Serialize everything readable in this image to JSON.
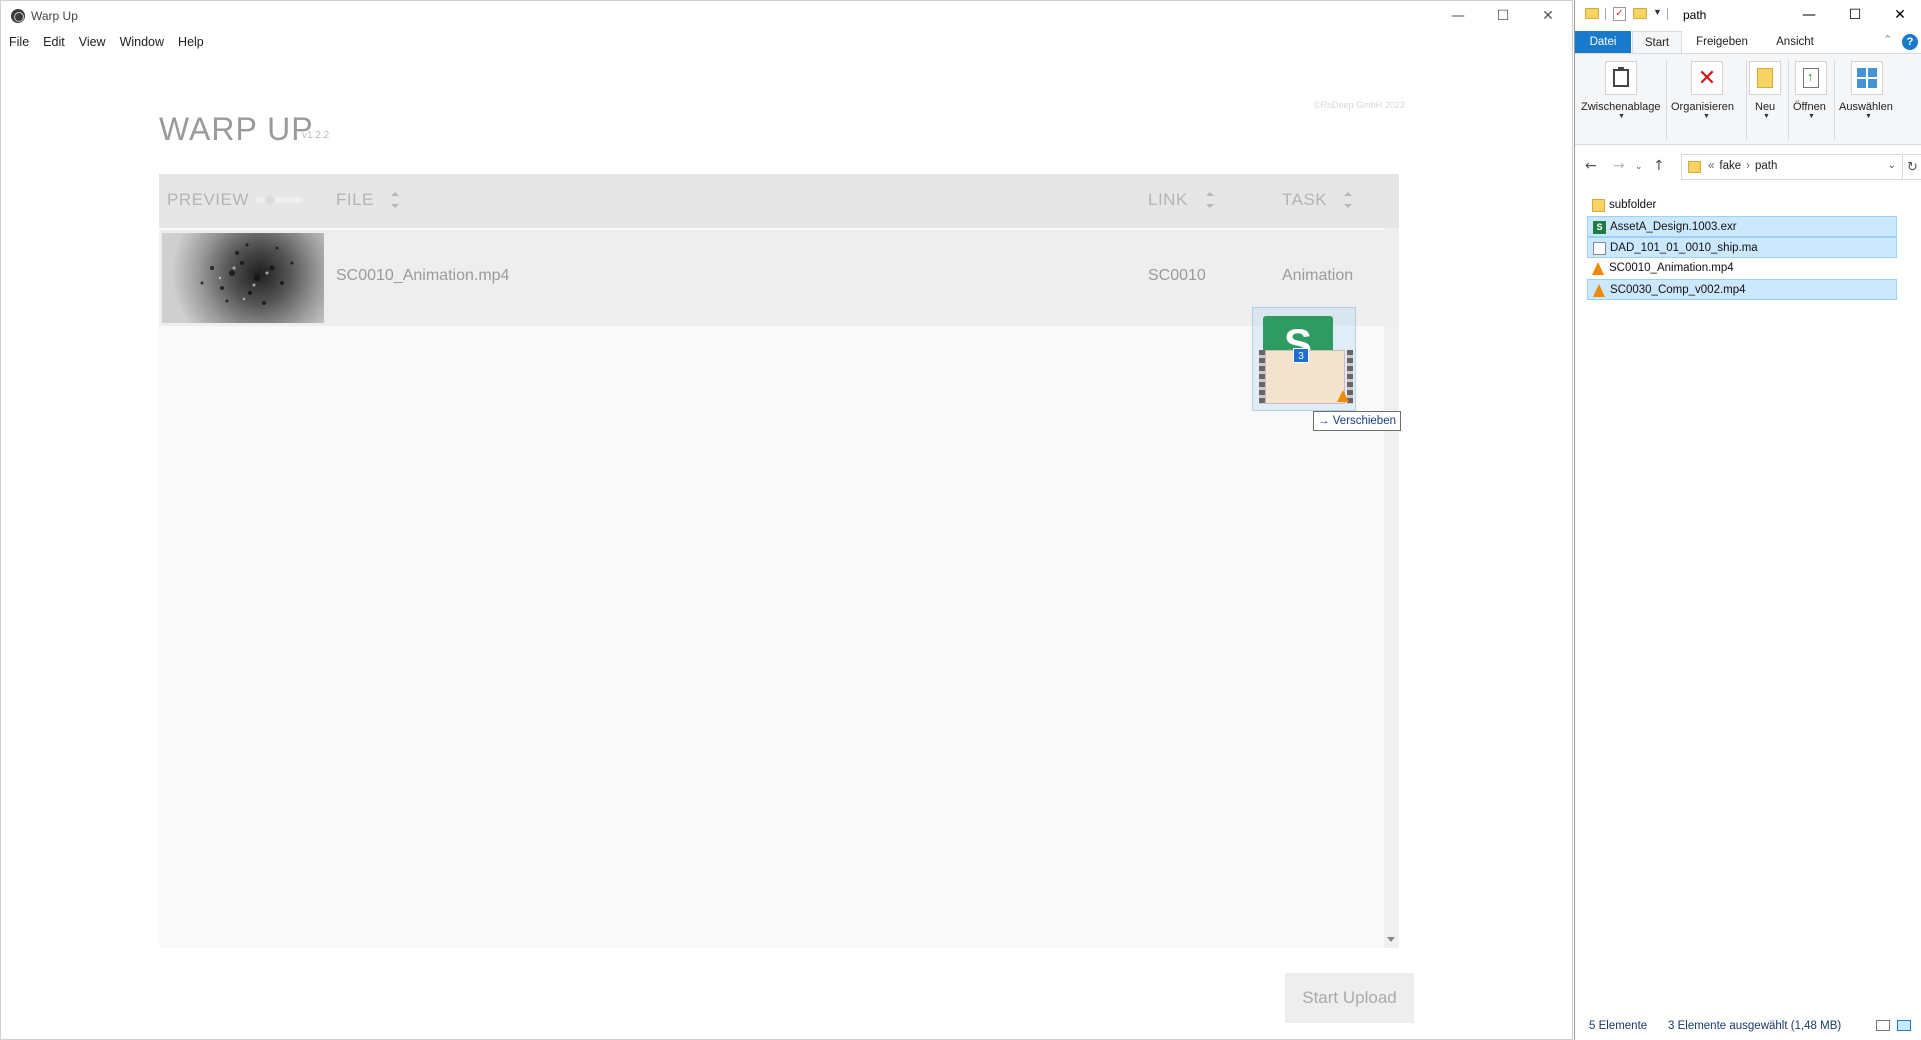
{
  "warp": {
    "window_title": "Warp Up",
    "menu": [
      "File",
      "Edit",
      "View",
      "Window",
      "Help"
    ],
    "title": "WARP UP",
    "version": "v1.2.2",
    "copyright": "©RnDeep GmbH 2023",
    "columns": {
      "preview": "PREVIEW",
      "file": "FILE",
      "link": "LINK",
      "task": "TASK"
    },
    "rows": [
      {
        "file": "SC0010_Animation.mp4",
        "link": "SC0010",
        "task": "Animation"
      }
    ],
    "upload_label": "Start Upload"
  },
  "drag": {
    "count": "3",
    "tooltip": "Verschieben"
  },
  "explorer": {
    "window_title": "path",
    "tabs": [
      "Datei",
      "Start",
      "Freigeben",
      "Ansicht"
    ],
    "ribbon_groups": [
      "Zwischenablage",
      "Organisieren",
      "Neu",
      "Öffnen",
      "Auswählen"
    ],
    "breadcrumb": [
      "fake",
      "path"
    ],
    "files": [
      {
        "name": "subfolder",
        "icon": "folder-icon",
        "selected": false
      },
      {
        "name": "AssetA_Design.1003.exr",
        "icon": "sheet-icon",
        "selected": true
      },
      {
        "name": "DAD_101_01_0010_ship.ma",
        "icon": "document-icon",
        "selected": true
      },
      {
        "name": "SC0010_Animation.mp4",
        "icon": "vlc-icon",
        "selected": false
      },
      {
        "name": "SC0030_Comp_v002.mp4",
        "icon": "vlc-icon",
        "selected": true
      }
    ],
    "status_count": "5 Elemente",
    "status_selected": "3 Elemente ausgewählt (1,48 MB)"
  },
  "colors": {
    "accent": "#1979ca",
    "selection": "#cce8ff",
    "header_bg": "#e6e6e6"
  }
}
